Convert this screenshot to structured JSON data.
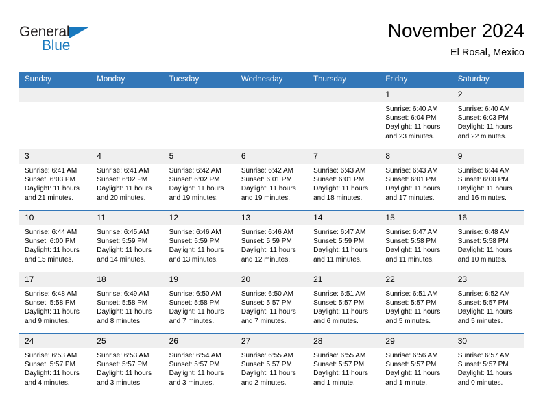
{
  "logo": {
    "word1": "General",
    "word2": "Blue",
    "triangle_color": "#1878be",
    "text_color": "#231f20"
  },
  "header": {
    "title": "November 2024",
    "subtitle": "El Rosal, Mexico"
  },
  "theme": {
    "header_blue": "#3377b8",
    "daynum_gray": "#efefef",
    "row_line": "#3377b8"
  },
  "calendar": {
    "weekdays": [
      "Sunday",
      "Monday",
      "Tuesday",
      "Wednesday",
      "Thursday",
      "Friday",
      "Saturday"
    ],
    "weeks": [
      [
        {
          "day": "",
          "lines": []
        },
        {
          "day": "",
          "lines": []
        },
        {
          "day": "",
          "lines": []
        },
        {
          "day": "",
          "lines": []
        },
        {
          "day": "",
          "lines": []
        },
        {
          "day": "1",
          "sunrise": "Sunrise: 6:40 AM",
          "sunset": "Sunset: 6:04 PM",
          "daylight": "Daylight: 11 hours and 23 minutes."
        },
        {
          "day": "2",
          "sunrise": "Sunrise: 6:40 AM",
          "sunset": "Sunset: 6:03 PM",
          "daylight": "Daylight: 11 hours and 22 minutes."
        }
      ],
      [
        {
          "day": "3",
          "sunrise": "Sunrise: 6:41 AM",
          "sunset": "Sunset: 6:03 PM",
          "daylight": "Daylight: 11 hours and 21 minutes."
        },
        {
          "day": "4",
          "sunrise": "Sunrise: 6:41 AM",
          "sunset": "Sunset: 6:02 PM",
          "daylight": "Daylight: 11 hours and 20 minutes."
        },
        {
          "day": "5",
          "sunrise": "Sunrise: 6:42 AM",
          "sunset": "Sunset: 6:02 PM",
          "daylight": "Daylight: 11 hours and 19 minutes."
        },
        {
          "day": "6",
          "sunrise": "Sunrise: 6:42 AM",
          "sunset": "Sunset: 6:01 PM",
          "daylight": "Daylight: 11 hours and 19 minutes."
        },
        {
          "day": "7",
          "sunrise": "Sunrise: 6:43 AM",
          "sunset": "Sunset: 6:01 PM",
          "daylight": "Daylight: 11 hours and 18 minutes."
        },
        {
          "day": "8",
          "sunrise": "Sunrise: 6:43 AM",
          "sunset": "Sunset: 6:01 PM",
          "daylight": "Daylight: 11 hours and 17 minutes."
        },
        {
          "day": "9",
          "sunrise": "Sunrise: 6:44 AM",
          "sunset": "Sunset: 6:00 PM",
          "daylight": "Daylight: 11 hours and 16 minutes."
        }
      ],
      [
        {
          "day": "10",
          "sunrise": "Sunrise: 6:44 AM",
          "sunset": "Sunset: 6:00 PM",
          "daylight": "Daylight: 11 hours and 15 minutes."
        },
        {
          "day": "11",
          "sunrise": "Sunrise: 6:45 AM",
          "sunset": "Sunset: 5:59 PM",
          "daylight": "Daylight: 11 hours and 14 minutes."
        },
        {
          "day": "12",
          "sunrise": "Sunrise: 6:46 AM",
          "sunset": "Sunset: 5:59 PM",
          "daylight": "Daylight: 11 hours and 13 minutes."
        },
        {
          "day": "13",
          "sunrise": "Sunrise: 6:46 AM",
          "sunset": "Sunset: 5:59 PM",
          "daylight": "Daylight: 11 hours and 12 minutes."
        },
        {
          "day": "14",
          "sunrise": "Sunrise: 6:47 AM",
          "sunset": "Sunset: 5:59 PM",
          "daylight": "Daylight: 11 hours and 11 minutes."
        },
        {
          "day": "15",
          "sunrise": "Sunrise: 6:47 AM",
          "sunset": "Sunset: 5:58 PM",
          "daylight": "Daylight: 11 hours and 11 minutes."
        },
        {
          "day": "16",
          "sunrise": "Sunrise: 6:48 AM",
          "sunset": "Sunset: 5:58 PM",
          "daylight": "Daylight: 11 hours and 10 minutes."
        }
      ],
      [
        {
          "day": "17",
          "sunrise": "Sunrise: 6:48 AM",
          "sunset": "Sunset: 5:58 PM",
          "daylight": "Daylight: 11 hours and 9 minutes."
        },
        {
          "day": "18",
          "sunrise": "Sunrise: 6:49 AM",
          "sunset": "Sunset: 5:58 PM",
          "daylight": "Daylight: 11 hours and 8 minutes."
        },
        {
          "day": "19",
          "sunrise": "Sunrise: 6:50 AM",
          "sunset": "Sunset: 5:58 PM",
          "daylight": "Daylight: 11 hours and 7 minutes."
        },
        {
          "day": "20",
          "sunrise": "Sunrise: 6:50 AM",
          "sunset": "Sunset: 5:57 PM",
          "daylight": "Daylight: 11 hours and 7 minutes."
        },
        {
          "day": "21",
          "sunrise": "Sunrise: 6:51 AM",
          "sunset": "Sunset: 5:57 PM",
          "daylight": "Daylight: 11 hours and 6 minutes."
        },
        {
          "day": "22",
          "sunrise": "Sunrise: 6:51 AM",
          "sunset": "Sunset: 5:57 PM",
          "daylight": "Daylight: 11 hours and 5 minutes."
        },
        {
          "day": "23",
          "sunrise": "Sunrise: 6:52 AM",
          "sunset": "Sunset: 5:57 PM",
          "daylight": "Daylight: 11 hours and 5 minutes."
        }
      ],
      [
        {
          "day": "24",
          "sunrise": "Sunrise: 6:53 AM",
          "sunset": "Sunset: 5:57 PM",
          "daylight": "Daylight: 11 hours and 4 minutes."
        },
        {
          "day": "25",
          "sunrise": "Sunrise: 6:53 AM",
          "sunset": "Sunset: 5:57 PM",
          "daylight": "Daylight: 11 hours and 3 minutes."
        },
        {
          "day": "26",
          "sunrise": "Sunrise: 6:54 AM",
          "sunset": "Sunset: 5:57 PM",
          "daylight": "Daylight: 11 hours and 3 minutes."
        },
        {
          "day": "27",
          "sunrise": "Sunrise: 6:55 AM",
          "sunset": "Sunset: 5:57 PM",
          "daylight": "Daylight: 11 hours and 2 minutes."
        },
        {
          "day": "28",
          "sunrise": "Sunrise: 6:55 AM",
          "sunset": "Sunset: 5:57 PM",
          "daylight": "Daylight: 11 hours and 1 minute."
        },
        {
          "day": "29",
          "sunrise": "Sunrise: 6:56 AM",
          "sunset": "Sunset: 5:57 PM",
          "daylight": "Daylight: 11 hours and 1 minute."
        },
        {
          "day": "30",
          "sunrise": "Sunrise: 6:57 AM",
          "sunset": "Sunset: 5:57 PM",
          "daylight": "Daylight: 11 hours and 0 minutes."
        }
      ]
    ]
  }
}
